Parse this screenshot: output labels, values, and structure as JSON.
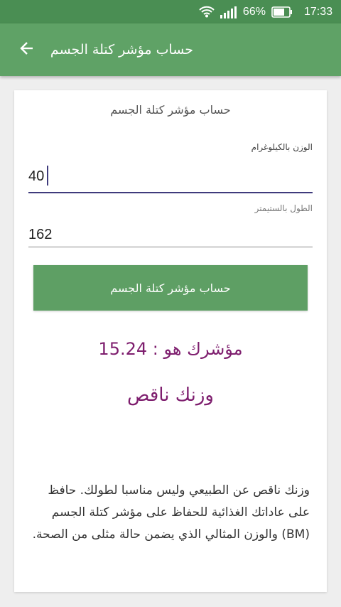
{
  "status_bar": {
    "battery": "66%",
    "time": "17:33",
    "icons": [
      "wifi-icon",
      "signal-icon",
      "battery-icon"
    ]
  },
  "app_bar": {
    "title": "حساب مؤشر كتلة الجسم",
    "back_icon": "arrow-back-icon"
  },
  "card": {
    "title": "حساب مؤشر كتلة الجسم",
    "weight": {
      "label": "الوزن بالكيلوغرام",
      "value": "40"
    },
    "height": {
      "label": "الطول بالستيمتر",
      "value": "162"
    },
    "calculate_button": "حساب مؤشر كتلة الجسم",
    "result_text": "مؤشرك هو  :  15.24",
    "status_text": "وزنك ناقص",
    "advice_text": "وزنك ناقص عن الطبيعي وليس مناسبا لطولك. حافظ على عاداتك الغذائية للحفاظ على مؤشر كتلة الجسم (BM) والوزن المثالي الذي يضمن حالة مثلى من الصحة."
  },
  "colors": {
    "status_bar": "#4a8e53",
    "app_bar": "#5fa266",
    "button": "#5e9f64",
    "result": "#7e1e6e",
    "active_underline": "#3f3b7c"
  }
}
